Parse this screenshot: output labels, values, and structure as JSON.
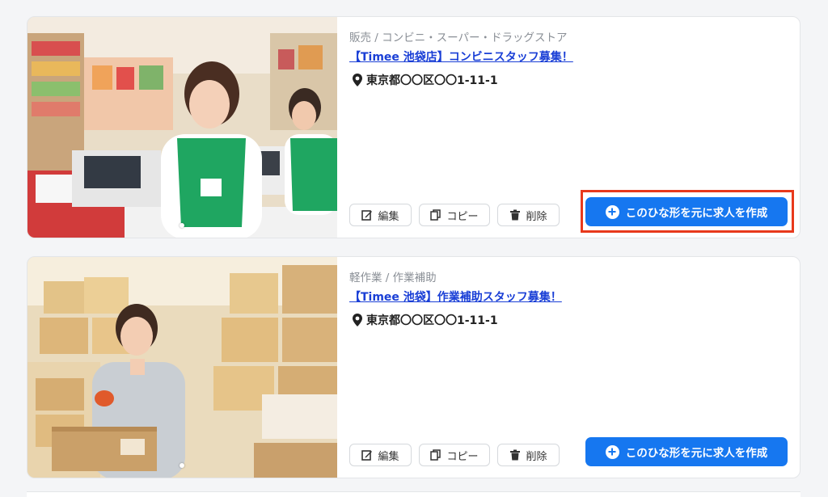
{
  "jobs": [
    {
      "category": "販売 / コンビニ・スーパー・ドラッグストア",
      "title": "【Timee 池袋店】コンビニスタッフ募集！",
      "address": "東京都〇〇区〇〇1-11-1",
      "edit_label": "編集",
      "copy_label": "コピー",
      "delete_label": "削除",
      "create_label": "このひな形を元に求人を作成"
    },
    {
      "category": "軽作業 / 作業補助",
      "title": "【Timee 池袋】作業補助スタッフ募集！",
      "address": "東京都〇〇区〇〇1-11-1",
      "edit_label": "編集",
      "copy_label": "コピー",
      "delete_label": "削除",
      "create_label": "このひな形を元に求人を作成"
    }
  ],
  "colors": {
    "primary_button": "#1677f0",
    "link": "#1a3fd6",
    "highlight": "#e8391c"
  }
}
